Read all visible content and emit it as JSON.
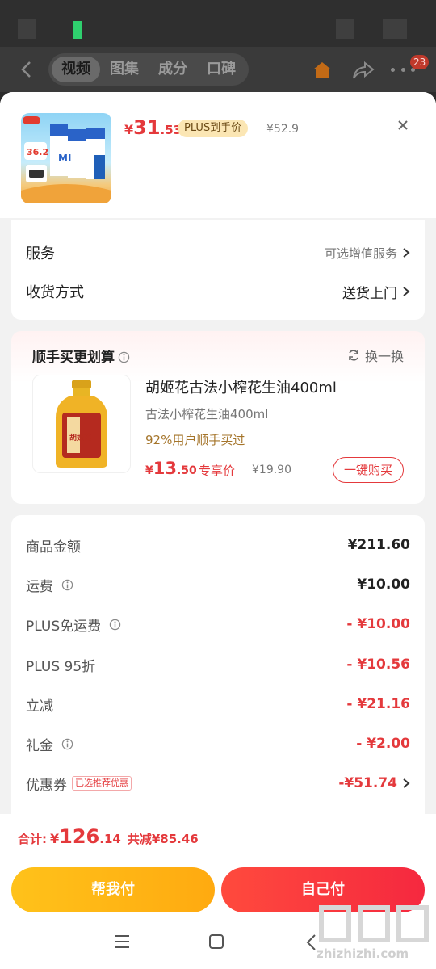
{
  "top_nav": {
    "tabs": [
      {
        "label": "视频",
        "active": true
      },
      {
        "label": "图集",
        "active": false
      },
      {
        "label": "成分",
        "active": false
      },
      {
        "label": "口碑",
        "active": false
      }
    ],
    "more_badge": "23",
    "icons": [
      "back-icon",
      "home-icon",
      "share-icon",
      "more-icon"
    ]
  },
  "product": {
    "price_symbol": "¥",
    "price_int": "31",
    "price_dec": ".53",
    "plus_tag": "PLUS到手价",
    "original_price": "¥52.9",
    "thumb_text": "36.2"
  },
  "service_rows": [
    {
      "label": "服务",
      "value": "可选增值服务"
    },
    {
      "label": "收货方式",
      "value": "送货上门"
    }
  ],
  "combo": {
    "title": "顺手买更划算",
    "swap_label": "换一换",
    "name": "胡姬花古法小榨花生油400ml",
    "subtitle": "古法小榨花生油400ml",
    "stat": "92%用户顺手买过",
    "price_symbol": "¥",
    "price_int": "13",
    "price_dec": ".50",
    "price_tag": "专享价",
    "original_price": "¥19.90",
    "buy_label": "一键购买",
    "bottle_label": "胡姬花"
  },
  "summary": {
    "rows": [
      {
        "label": "商品金额",
        "value": "¥211.60"
      },
      {
        "label": "运费",
        "value": "¥10.00"
      },
      {
        "label": "PLUS免运费",
        "value": "- ¥10.00"
      },
      {
        "label": "PLUS 95折",
        "value": "- ¥10.56"
      },
      {
        "label": "立减",
        "value": "- ¥21.16"
      },
      {
        "label": "礼金",
        "value": "- ¥2.00"
      },
      {
        "label": "优惠券",
        "value": "-¥51.74",
        "tag": "已选推荐优惠"
      }
    ]
  },
  "footer": {
    "total_label": "合计:",
    "total_symbol": "¥",
    "total_int": "126",
    "total_dec": ".14",
    "saved": "共减¥85.46",
    "helper_pay": "帮我付",
    "self_pay": "自己付"
  },
  "watermark": {
    "text": "zhizhizhi.com"
  },
  "colors": {
    "accent": "#e4393c",
    "plus_gold": "#fbe6b4",
    "helper_btn": "#ffb514",
    "self_btn": "#f5283f"
  }
}
